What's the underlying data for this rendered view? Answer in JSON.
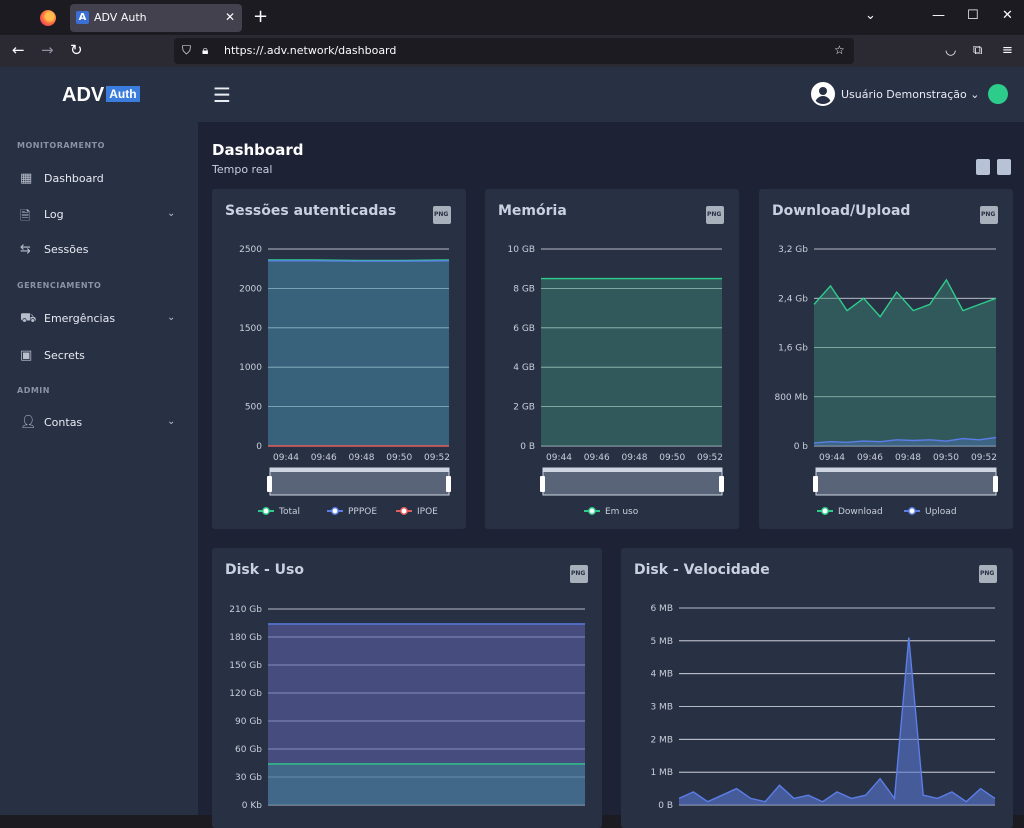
{
  "browser": {
    "tab_title": "ADV Auth",
    "tab_favicon": "A",
    "url": "https://.adv.network/dashboard",
    "new_tab": "+",
    "close_tab": "✕"
  },
  "sidebar": {
    "brand": "ADV",
    "brand_badge": "Auth",
    "sections": [
      {
        "title": "MONITORAMENTO"
      },
      {
        "title": "GERENCIAMENTO"
      },
      {
        "title": "ADMIN"
      }
    ],
    "items": [
      {
        "label": "Dashboard",
        "icon": "dashboard-icon"
      },
      {
        "label": "Log",
        "icon": "log-icon",
        "expandable": true
      },
      {
        "label": "Sessões",
        "icon": "sessions-icon"
      },
      {
        "label": "Emergências",
        "icon": "car-icon",
        "expandable": true
      },
      {
        "label": "Secrets",
        "icon": "secrets-icon"
      },
      {
        "label": "Contas",
        "icon": "user-icon",
        "expandable": true
      }
    ]
  },
  "header": {
    "user_name": "Usuário Demonstração",
    "status_color": "#2ecc8b"
  },
  "page": {
    "title": "Dashboard",
    "subtitle": "Tempo real"
  },
  "colors": {
    "green": "#2ecc8b",
    "blue": "#5b7ee8",
    "red": "#e25d5d",
    "card_bg": "#283044",
    "content_bg": "#1d2235"
  },
  "chart_data": [
    {
      "type": "area",
      "title": "Sessões autenticadas",
      "x": [
        "09:44",
        "09:46",
        "09:48",
        "09:50",
        "09:52"
      ],
      "y_ticks": [
        "0",
        "500",
        "1000",
        "1500",
        "2000",
        "2500"
      ],
      "ylim": [
        0,
        2500
      ],
      "series": [
        {
          "name": "Total",
          "values": [
            2360,
            2360,
            2355,
            2355,
            2360
          ]
        },
        {
          "name": "PPPOE",
          "values": [
            2350,
            2350,
            2345,
            2345,
            2350
          ]
        },
        {
          "name": "IPOE",
          "values": [
            0,
            0,
            0,
            0,
            0
          ]
        }
      ],
      "legend": "bottom"
    },
    {
      "type": "area",
      "title": "Memória",
      "x": [
        "09:44",
        "09:46",
        "09:48",
        "09:50",
        "09:52"
      ],
      "y_ticks": [
        "0 B",
        "2 GB",
        "4 GB",
        "6 GB",
        "8 GB",
        "10 GB"
      ],
      "ylim": [
        0,
        10
      ],
      "series": [
        {
          "name": "Em uso",
          "values": [
            8.5,
            8.5,
            8.5,
            8.5,
            8.5
          ]
        }
      ],
      "legend": "bottom"
    },
    {
      "type": "area",
      "title": "Download/Upload",
      "x": [
        "09:44",
        "09:46",
        "09:48",
        "09:50",
        "09:52"
      ],
      "y_ticks": [
        "0 b",
        "800 Mb",
        "1,6 Gb",
        "2,4 Gb",
        "3,2 Gb"
      ],
      "ylim": [
        0,
        3.2
      ],
      "series": [
        {
          "name": "Download",
          "values": [
            2.3,
            2.6,
            2.2,
            2.4,
            2.1,
            2.5,
            2.2,
            2.3,
            2.7,
            2.2,
            2.3,
            2.4
          ]
        },
        {
          "name": "Upload",
          "values": [
            0.05,
            0.07,
            0.06,
            0.08,
            0.07,
            0.1,
            0.09,
            0.1,
            0.08,
            0.12,
            0.1,
            0.14
          ]
        }
      ],
      "legend": "bottom"
    },
    {
      "type": "area",
      "title": "Disk - Uso",
      "y_ticks": [
        "0 Kb",
        "30 Gb",
        "60 Gb",
        "90 Gb",
        "120 Gb",
        "150 Gb",
        "180 Gb",
        "210 Gb"
      ],
      "ylim": [
        0,
        210
      ],
      "series": [
        {
          "name": "",
          "values": [
            194,
            194,
            194,
            194,
            194
          ]
        },
        {
          "name": "",
          "values": [
            44,
            44,
            44,
            44,
            44
          ]
        }
      ]
    },
    {
      "type": "area",
      "title": "Disk - Velocidade",
      "y_ticks": [
        "0 B",
        "1 MB",
        "2 MB",
        "3 MB",
        "4 MB",
        "5 MB",
        "6 MB"
      ],
      "ylim": [
        0,
        6
      ],
      "series": [
        {
          "name": "",
          "values": [
            0.2,
            0.4,
            0.1,
            0.3,
            0.5,
            0.2,
            0.1,
            0.6,
            0.2,
            0.3,
            0.1,
            0.4,
            0.2,
            0.3,
            0.8,
            0.2,
            5.1,
            0.3,
            0.2,
            0.4,
            0.1,
            0.5,
            0.2
          ]
        }
      ]
    }
  ]
}
